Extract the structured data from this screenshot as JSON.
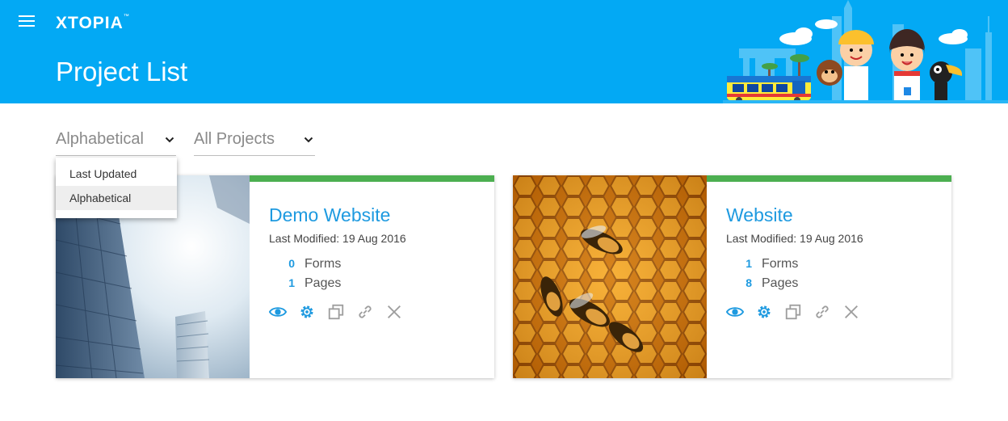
{
  "app": {
    "logo": "XTOPIA",
    "logo_tm": "™",
    "page_title": "Project List"
  },
  "filters": {
    "sort": {
      "value": "Alphabetical"
    },
    "project": {
      "value": "All Projects"
    }
  },
  "sort_options": [
    {
      "label": "Last Updated",
      "selected": false
    },
    {
      "label": "Alphabetical",
      "selected": true
    }
  ],
  "projects": [
    {
      "title": "Demo Website",
      "modified": "Last Modified: 19 Aug 2016",
      "forms_count": "0",
      "forms_label": "Forms",
      "pages_count": "1",
      "pages_label": "Pages",
      "thumbnail": "skyscrapers-photo"
    },
    {
      "title": "Website",
      "modified": "Last Modified: 19 Aug 2016",
      "forms_count": "1",
      "forms_label": "Forms",
      "pages_count": "8",
      "pages_label": "Pages",
      "thumbnail": "honeycomb-bees-photo"
    }
  ],
  "colors": {
    "header": "#03a9f4",
    "accent": "#1e9ae0",
    "card_top_bar": "#4caf50",
    "icon_active": "#1e9ae0",
    "icon_inactive": "#9e9e9e"
  }
}
